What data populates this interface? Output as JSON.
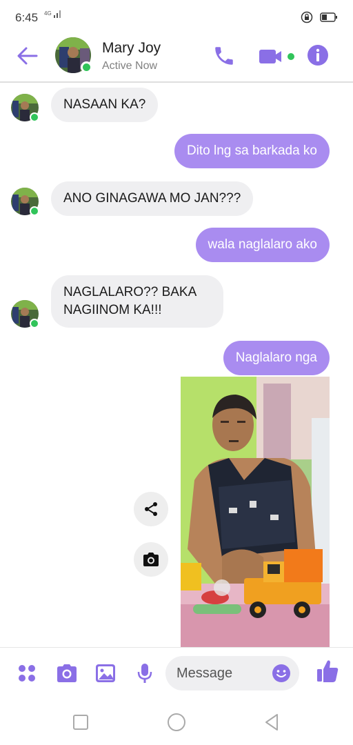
{
  "status_bar": {
    "time": "6:45",
    "network": "4G"
  },
  "header": {
    "contact_name": "Mary Joy",
    "contact_status": "Active Now"
  },
  "messages": [
    {
      "direction": "incoming",
      "text": "NASAAN KA?"
    },
    {
      "direction": "outgoing",
      "text": "Dito lng sa barkada ko"
    },
    {
      "direction": "incoming",
      "text": "ANO GINAGAWA MO JAN???"
    },
    {
      "direction": "outgoing",
      "text": "wala naglalaro ako"
    },
    {
      "direction": "incoming",
      "text": "NAGLALARO?? BAKA NAGIINOM KA!!!"
    },
    {
      "direction": "outgoing",
      "text": "Naglalaro nga"
    }
  ],
  "composer": {
    "placeholder": "Message"
  },
  "colors": {
    "accent": "#a98cf0",
    "icon": "#8a6fe6",
    "active_dot": "#31c45a",
    "incoming_bubble": "#efeff1"
  },
  "icons": [
    "back-arrow-icon",
    "phone-icon",
    "video-icon",
    "info-icon",
    "share-icon",
    "camera-icon",
    "apps-icon",
    "gallery-icon",
    "mic-icon",
    "emoji-icon",
    "thumbs-up-icon"
  ]
}
